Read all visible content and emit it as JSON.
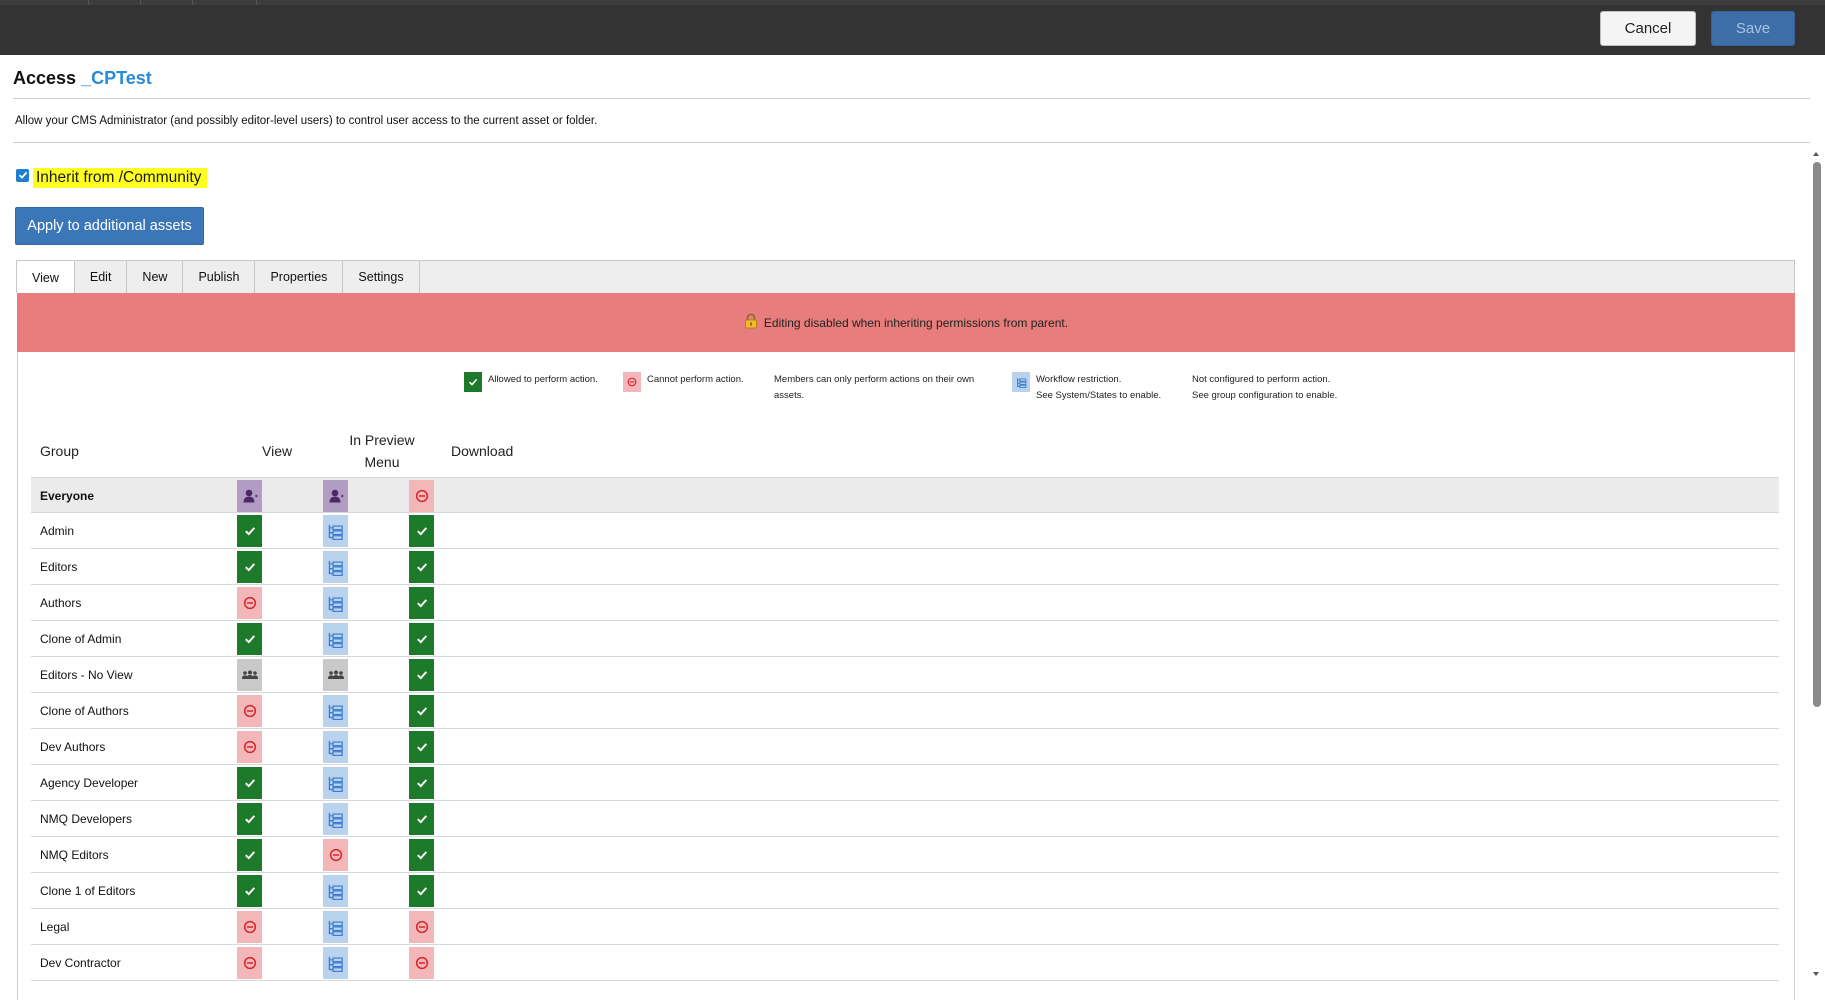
{
  "toolbar": {
    "cancel_label": "Cancel",
    "save_label": "Save"
  },
  "header": {
    "title": "Access",
    "asset_name": "_CPTest"
  },
  "description": "Allow your CMS Administrator (and possibly editor-level users) to control user access to the current asset or folder.",
  "inherit": {
    "checked": true,
    "label": "Inherit from /Community"
  },
  "apply_button_label": "Apply to additional assets",
  "tabs": [
    {
      "label": "View",
      "active": true
    },
    {
      "label": "Edit",
      "active": false
    },
    {
      "label": "New",
      "active": false
    },
    {
      "label": "Publish",
      "active": false
    },
    {
      "label": "Properties",
      "active": false
    },
    {
      "label": "Settings",
      "active": false
    }
  ],
  "banner_text": "Editing disabled when inheriting permissions from parent.",
  "legend": {
    "allowed": "Allowed to perform action.",
    "denied": "Cannot perform action.",
    "own_line1": "Members can only perform actions on their own",
    "own_line2": "assets.",
    "workflow_line1": "Workflow restriction.",
    "workflow_line2": "See System/States to enable.",
    "notconfigured_line1": "Not configured to perform action.",
    "notconfigured_line2": "See group configuration to enable."
  },
  "table": {
    "headers": {
      "group": "Group",
      "view": "View",
      "preview_line1": "In Preview",
      "preview_line2": "Menu",
      "download": "Download"
    },
    "rows": [
      {
        "group": "Everyone",
        "view": "own",
        "preview": "own",
        "download": "deny"
      },
      {
        "group": "Admin",
        "view": "allow",
        "preview": "workflow",
        "download": "allow"
      },
      {
        "group": "Editors",
        "view": "allow",
        "preview": "workflow",
        "download": "allow"
      },
      {
        "group": "Authors",
        "view": "deny",
        "preview": "workflow",
        "download": "allow"
      },
      {
        "group": "Clone of Admin",
        "view": "allow",
        "preview": "workflow",
        "download": "allow"
      },
      {
        "group": "Editors - No View",
        "view": "group",
        "preview": "group",
        "download": "allow"
      },
      {
        "group": "Clone of Authors",
        "view": "deny",
        "preview": "workflow",
        "download": "allow"
      },
      {
        "group": "Dev Authors",
        "view": "deny",
        "preview": "workflow",
        "download": "allow"
      },
      {
        "group": "Agency Developer",
        "view": "allow",
        "preview": "workflow",
        "download": "allow"
      },
      {
        "group": "NMQ Developers",
        "view": "allow",
        "preview": "workflow",
        "download": "allow"
      },
      {
        "group": "NMQ Editors",
        "view": "allow",
        "preview": "deny",
        "download": "allow"
      },
      {
        "group": "Clone 1 of Editors",
        "view": "allow",
        "preview": "workflow",
        "download": "allow"
      },
      {
        "group": "Legal",
        "view": "deny",
        "preview": "workflow",
        "download": "deny"
      },
      {
        "group": "Dev Contractor",
        "view": "deny",
        "preview": "workflow",
        "download": "deny"
      }
    ]
  },
  "icon_names": {
    "allow": "check-icon",
    "deny": "no-entry-icon",
    "workflow": "workflow-icon",
    "own": "user-icon",
    "group": "group-icon",
    "lock": "lock-icon"
  },
  "colors": {
    "allow": "#1e7a2b",
    "deny": "#f4b7b9",
    "workflow": "#b9d2ee",
    "own": "#b19cc4",
    "group": "#c9c9c9",
    "banner": "#e87d7d",
    "highlight": "#ffff20",
    "primary_button": "#3b76b8"
  }
}
